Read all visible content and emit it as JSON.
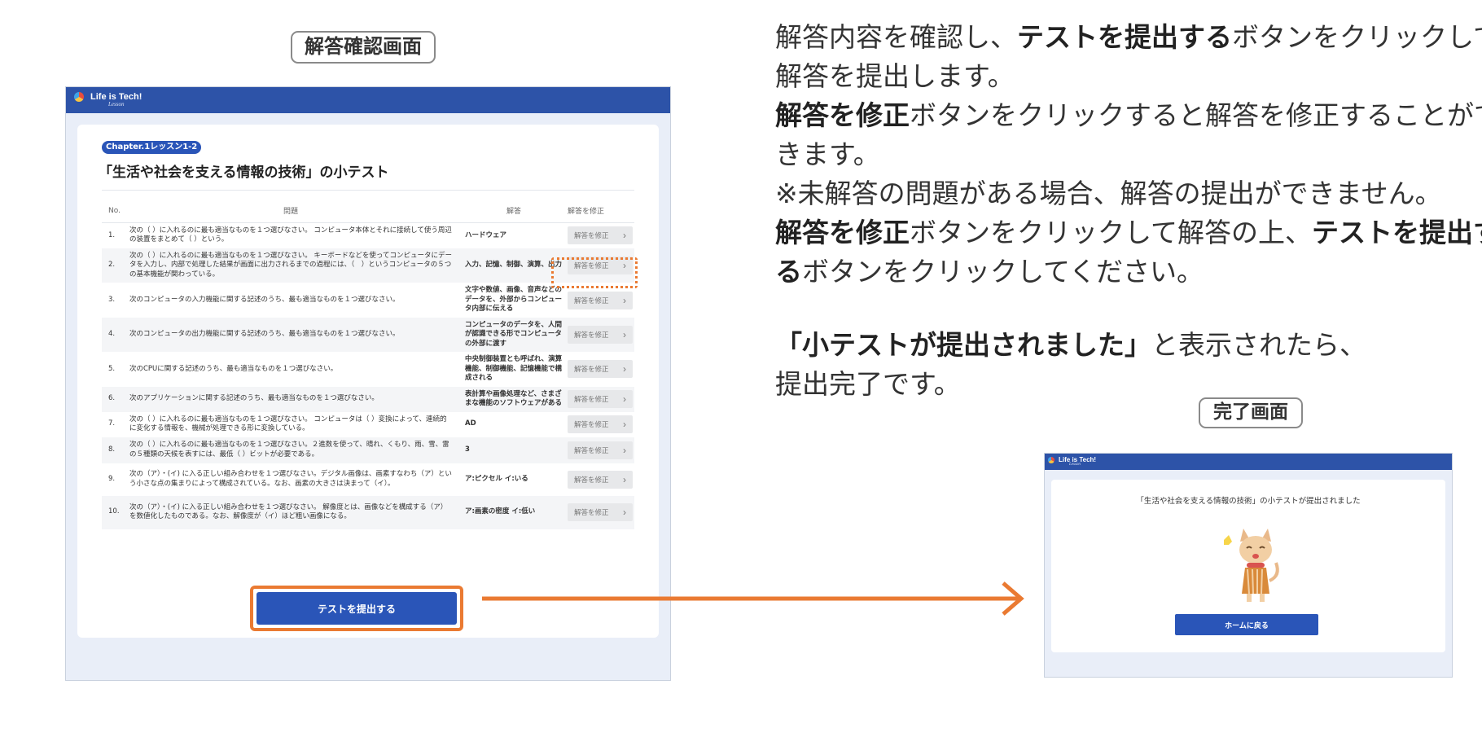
{
  "confirm_caption": "解答確認画面",
  "complete_caption": "完了画面",
  "app": {
    "logo_text": "Life is Tech!",
    "logo_sub": "Lesson"
  },
  "quiz": {
    "chapter_tag": "Chapter.1レッスン1-2",
    "title": "「生活や社会を支える情報の技術」の小テスト",
    "headers": {
      "no": "No.",
      "question": "問題",
      "answer": "解答",
      "fix": "解答を修正"
    },
    "fix_label": "解答を修正",
    "rows": [
      {
        "no": "1.",
        "question": "次の（ ）に入れるのに最も適当なものを１つ選びなさい。 コンピュータ本体とそれに接続して使う周辺の装置をまとめて（ ）という。",
        "answer": "ハードウェア"
      },
      {
        "no": "2.",
        "question": "次の（ ）に入れるのに最も適当なものを１つ選びなさい。 キーボードなどを使ってコンピュータにデータを入力し、内部で処理した結果が画面に出力されるまでの過程には、（　）というコンピュータの５つの基本機能が関わっている。",
        "answer": "入力、記憶、制御、演算、出力"
      },
      {
        "no": "3.",
        "question": "次のコンピュータの入力機能に関する記述のうち、最も適当なものを１つ選びなさい。",
        "answer": "文字や数値、画像、音声などのデータを、外部からコンピュータ内部に伝える"
      },
      {
        "no": "4.",
        "question": "次のコンピュータの出力機能に関する記述のうち、最も適当なものを１つ選びなさい。",
        "answer": "コンピュータのデータを、人間が認識できる形でコンピュータの外部に渡す"
      },
      {
        "no": "5.",
        "question": "次のCPUに関する記述のうち、最も適当なものを１つ選びなさい。",
        "answer": "中央制御装置とも呼ばれ、演算機能、制御機能、記憶機能で構成される"
      },
      {
        "no": "6.",
        "question": "次のアプリケーションに関する記述のうち、最も適当なものを１つ選びなさい。",
        "answer": "表計算や画像処理など、さまざまな機能のソフトウェアがある"
      },
      {
        "no": "7.",
        "question": "次の（ ）に入れるのに最も適当なものを１つ選びなさい。 コンピュータは（ ）変換によって、連続的に変化する情報を、機械が処理できる形に変換している。",
        "answer": "AD"
      },
      {
        "no": "8.",
        "question": "次の（ ）に入れるのに最も適当なものを１つ選びなさい。２進数を使って、晴れ、くもり、雨、雪、雷の５種類の天候を表すには、最低（ ）ビットが必要である。",
        "answer": "3"
      },
      {
        "no": "9.",
        "question": "次の（ア）・(イ) に入る正しい組み合わせを１つ選びなさい。デジタル画像は、画素すなわち（ア）という小さな点の集まりによって構成されている。なお、画素の大きさは決まって（イ）。",
        "answer": "ア:ピクセル イ:いる"
      },
      {
        "no": "10.",
        "question": "次の（ア）・(イ) に入る正しい組み合わせを１つ選びなさい。 解像度とは、画像などを構成する（ア）を数値化したものである。なお、解像度が（イ）ほど粗い画像になる。",
        "answer": "ア:画素の密度 イ:低い"
      }
    ],
    "submit_label": "テストを提出する"
  },
  "description": {
    "line1_pre": "解答内容を確認し、",
    "line1_bold": "テストを提出する",
    "line1_post": "ボタンをクリックして",
    "line2": "解答を提出します。",
    "line3_bold": "解答を修正",
    "line3_post": "ボタンをクリックすると解答を修正することがで",
    "line4": "きます。",
    "line5": "※未解答の問題がある場合、解答の提出ができません。",
    "line6_bold": "解答を修正",
    "line6_mid": "ボタンをクリックして解答の上、",
    "line6_bold2": "テストを提出す",
    "line7_bold": "る",
    "line7_post": "ボタンをクリックしてください。",
    "line8_bold": "「小テストが提出されました」",
    "line8_post": "と表示されたら、",
    "line9": "提出完了です。"
  },
  "completion": {
    "message": "「生活や社会を支える情報の技術」の小テストが提出されました",
    "home_label": "ホームに戻る"
  },
  "colors": {
    "brand": "#2a55b8",
    "header": "#2d53a8",
    "highlight": "#ea7a32"
  }
}
